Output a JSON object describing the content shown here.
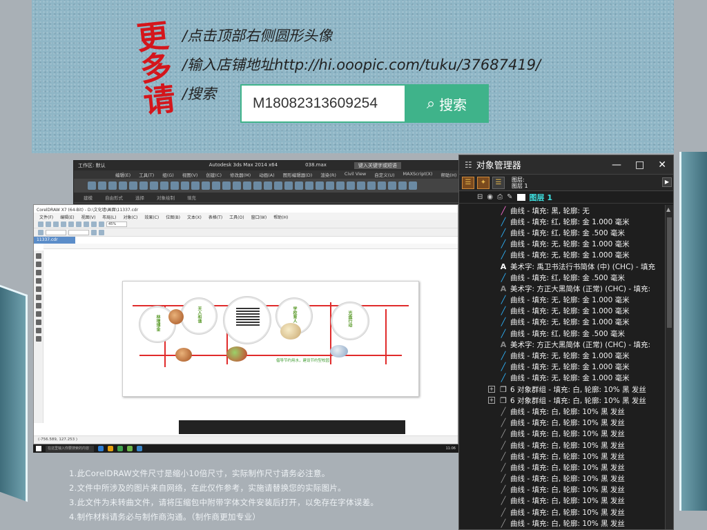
{
  "banner": {
    "brand_text": "更多请",
    "line1": "/点击顶部右侧圆形头像",
    "line2": "/输入店铺地址http://hi.ooopic.com/tuku/37687419/",
    "line3": "/搜索",
    "search_value": "M18082313609254",
    "search_button": "搜索"
  },
  "max_window": {
    "title": "Autodesk 3ds Max 2014 x64",
    "file": "038.max",
    "workspace": "工作区: 默认",
    "search_placeholder": "键入关键字或短语",
    "menu": [
      "编辑(E)",
      "工具(T)",
      "组(G)",
      "视图(V)",
      "创建(C)",
      "修改器(M)",
      "动画(A)",
      "图形编辑器(D)",
      "渲染(R)",
      "Civil View",
      "自定义(U)",
      "MAXScript(X)",
      "帮助(H)"
    ],
    "ribbon": [
      "建模",
      "自由形式",
      "选择",
      "对象绘制",
      "填充"
    ]
  },
  "corel_window": {
    "title": "CorelDRAW X7 (64-Bit) - D:\\文化墙\\画面\\11337.cdr",
    "menu": [
      "文件(F)",
      "编辑(E)",
      "视图(V)",
      "布局(L)",
      "对象(C)",
      "效果(C)",
      "位图(B)",
      "文本(X)",
      "表格(T)",
      "工具(O)",
      "窗口(W)",
      "帮助(H)"
    ],
    "zoom": "45%",
    "doc_tab": "11337.cdr",
    "artwork_slogan": "倡导节约用水，建设节约型校园",
    "status": "(-756.589, 127.253 )",
    "taskbar_search": "在这里输入你要搜索的内容"
  },
  "taskbar": {
    "clock": "11:06"
  },
  "object_manager": {
    "title": "对象管理器",
    "layer_info_1": "图层:",
    "layer_info_2": "图层 1",
    "layer_name": "图层 1",
    "rows": [
      {
        "kind": "curve",
        "selected": true,
        "text": "曲线 - 填充: 黑, 轮廓: 无"
      },
      {
        "kind": "curve",
        "text": "曲线 - 填充: 红, 轮廓: 金  1.000 毫米"
      },
      {
        "kind": "curve",
        "text": "曲线 - 填充: 红, 轮廓: 金  .500 毫米"
      },
      {
        "kind": "curve",
        "text": "曲线 - 填充: 无, 轮廓: 金  1.000 毫米"
      },
      {
        "kind": "curve",
        "text": "曲线 - 填充: 无, 轮廓: 金  1.000 毫米"
      },
      {
        "kind": "text",
        "text": "美术字:  禹卫书法行书简体 (中) (CHC) - 填充"
      },
      {
        "kind": "curve",
        "text": "曲线 - 填充: 红, 轮廓: 金  .500 毫米"
      },
      {
        "kind": "text",
        "dim": true,
        "text": "美术字:  方正大黑简体 (正常) (CHC) - 填充:"
      },
      {
        "kind": "curve",
        "text": "曲线 - 填充: 无, 轮廓: 金  1.000 毫米"
      },
      {
        "kind": "curve",
        "text": "曲线 - 填充: 无, 轮廓: 金  1.000 毫米"
      },
      {
        "kind": "curve",
        "text": "曲线 - 填充: 无, 轮廓: 金  1.000 毫米"
      },
      {
        "kind": "curve",
        "text": "曲线 - 填充: 红, 轮廓: 金  .500 毫米"
      },
      {
        "kind": "text",
        "dim": true,
        "text": "美术字:  方正大黑简体 (正常) (CHC) - 填充:"
      },
      {
        "kind": "curve",
        "text": "曲线 - 填充: 无, 轮廓: 金  1.000 毫米"
      },
      {
        "kind": "curve",
        "text": "曲线 - 填充: 无, 轮廓: 金  1.000 毫米"
      },
      {
        "kind": "curve",
        "text": "曲线 - 填充: 无, 轮廓: 金  1.000 毫米"
      },
      {
        "kind": "group",
        "text": "6 对象群组 - 填充: 白, 轮廓: 10% 黑 发丝"
      },
      {
        "kind": "group",
        "text": "6 对象群组 - 填充: 白, 轮廓: 10% 黑 发丝"
      },
      {
        "kind": "sub",
        "text": "曲线 - 填充: 白, 轮廓: 10% 黑 发丝"
      },
      {
        "kind": "sub",
        "text": "曲线 - 填充: 白, 轮廓: 10% 黑 发丝"
      },
      {
        "kind": "sub",
        "text": "曲线 - 填充: 白, 轮廓: 10% 黑 发丝"
      },
      {
        "kind": "sub",
        "text": "曲线 - 填充: 白, 轮廓: 10% 黑 发丝"
      },
      {
        "kind": "sub",
        "text": "曲线 - 填充: 白, 轮廓: 10% 黑 发丝"
      },
      {
        "kind": "sub",
        "text": "曲线 - 填充: 白, 轮廓: 10% 黑 发丝"
      },
      {
        "kind": "sub",
        "text": "曲线 - 填充: 白, 轮廓: 10% 黑 发丝"
      },
      {
        "kind": "sub",
        "text": "曲线 - 填充: 白, 轮廓: 10% 黑 发丝"
      },
      {
        "kind": "sub",
        "text": "曲线 - 填充: 白, 轮廓: 10% 黑 发丝"
      },
      {
        "kind": "sub",
        "text": "曲线 - 填充: 白, 轮廓: 10% 黑 发丝"
      },
      {
        "kind": "sub",
        "text": "曲线 - 填充: 白, 轮廓: 10% 黑 发丝"
      }
    ]
  },
  "notes": [
    "1.此CorelDRAW文件尺寸是缩小10倍尺寸，实际制作尺寸请务必注意。",
    "2.文件中所涉及的图片来自网络，在此仅作参考，实施请替换您的实际图片。",
    "3.此文件为未转曲文件，请将压缩包中附带字体文件安装后打开，以免存在字体误差。",
    "4.制作材料请务必与制作商沟通。（制作商更加专业）"
  ],
  "colors": {
    "accent_green": "#3fb38a",
    "brand_red": "#d4161c",
    "layer_cyan": "#3ee0e0"
  }
}
